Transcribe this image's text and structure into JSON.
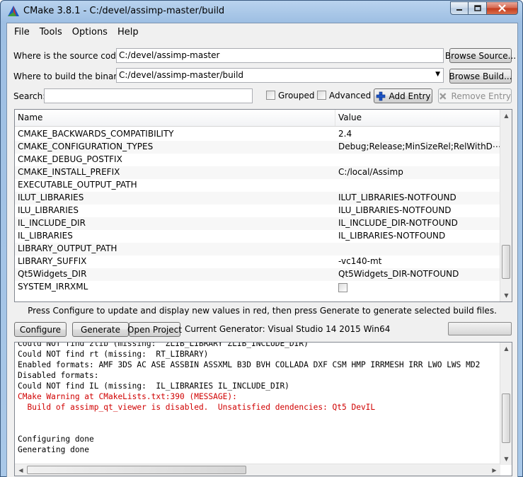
{
  "window": {
    "title": "CMake 3.8.1 - C:/devel/assimp-master/build",
    "minimize": "0",
    "maximize": "1",
    "close": "r"
  },
  "menu": [
    "File",
    "Tools",
    "Options",
    "Help"
  ],
  "source": {
    "label": "Where is the source code:",
    "value": "C:/devel/assimp-master",
    "browse": "Browse Source..."
  },
  "build": {
    "label": "Where to build the binaries:",
    "value": "C:/devel/assimp-master/build",
    "browse": "Browse Build..."
  },
  "search": {
    "label": "Search:",
    "value": ""
  },
  "options": {
    "grouped": "Grouped",
    "advanced": "Advanced",
    "add_entry": "Add Entry",
    "remove_entry": "Remove Entry"
  },
  "table": {
    "headers": [
      "Name",
      "Value"
    ],
    "rows": [
      {
        "name": "CMAKE_BACKWARDS_COMPATIBILITY",
        "value": "2.4"
      },
      {
        "name": "CMAKE_CONFIGURATION_TYPES",
        "value": "Debug;Release;MinSizeRel;RelWithD⋯"
      },
      {
        "name": "CMAKE_DEBUG_POSTFIX",
        "value": ""
      },
      {
        "name": "CMAKE_INSTALL_PREFIX",
        "value": "C:/local/Assimp"
      },
      {
        "name": "EXECUTABLE_OUTPUT_PATH",
        "value": ""
      },
      {
        "name": "ILUT_LIBRARIES",
        "value": "ILUT_LIBRARIES-NOTFOUND"
      },
      {
        "name": "ILU_LIBRARIES",
        "value": "ILU_LIBRARIES-NOTFOUND"
      },
      {
        "name": "IL_INCLUDE_DIR",
        "value": "IL_INCLUDE_DIR-NOTFOUND"
      },
      {
        "name": "IL_LIBRARIES",
        "value": "IL_LIBRARIES-NOTFOUND"
      },
      {
        "name": "LIBRARY_OUTPUT_PATH",
        "value": ""
      },
      {
        "name": "LIBRARY_SUFFIX",
        "value": "-vc140-mt"
      },
      {
        "name": "Qt5Widgets_DIR",
        "value": "Qt5Widgets_DIR-NOTFOUND"
      },
      {
        "name": "SYSTEM_IRRXML",
        "value": ""
      }
    ]
  },
  "hint": "Press Configure to update and display new values in red, then press Generate to generate selected build files.",
  "actions": {
    "configure": "Configure",
    "generate": "Generate",
    "open_project": "Open Project",
    "generator": "Current Generator: Visual Studio 14 2015 Win64"
  },
  "output": [
    {
      "text": "Could NOT find zlib (missing:  ZLIB_LIBRARY ZLIB_INCLUDE_DIR)",
      "red": false
    },
    {
      "text": "Could NOT find rt (missing:  RT_LIBRARY)",
      "red": false
    },
    {
      "text": "Enabled formats: AMF 3DS AC ASE ASSBIN ASSXML B3D BVH COLLADA DXF CSM HMP IRRMESH IRR LWO LWS MD2",
      "red": false
    },
    {
      "text": "Disabled formats:",
      "red": false
    },
    {
      "text": "Could NOT find IL (missing:  IL_LIBRARIES IL_INCLUDE_DIR)",
      "red": false
    },
    {
      "text": "CMake Warning at CMakeLists.txt:390 (MESSAGE):",
      "red": true
    },
    {
      "text": "  Build of assimp_qt_viewer is disabled.  Unsatisfied dendencies: Qt5 DevIL",
      "red": true
    },
    {
      "text": "",
      "red": false
    },
    {
      "text": "",
      "red": false
    },
    {
      "text": "Configuring done",
      "red": false
    },
    {
      "text": "Generating done",
      "red": false
    }
  ]
}
